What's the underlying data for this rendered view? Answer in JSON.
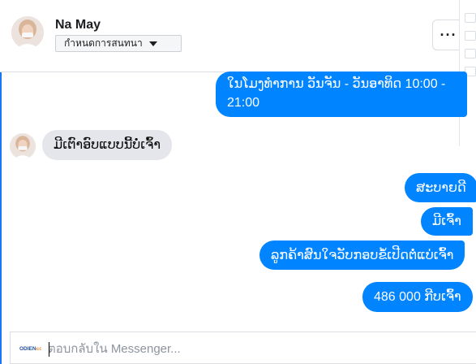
{
  "header": {
    "name": "Na May",
    "conversation_button_label": "กำหนดการสนทนา",
    "more_label": "···"
  },
  "messages": [
    {
      "direction": "outgoing",
      "text": "ໃນໂມງທຳການ ວັນຈັນ - ວັນອາທິດ  10:00 - 21:00"
    },
    {
      "direction": "incoming",
      "text": "ມີເຕົາອົບແບບນີ້ບໍ່ເຈົ້າ"
    },
    {
      "direction": "outgoing",
      "text": "ສະບາຍດີ"
    },
    {
      "direction": "outgoing",
      "text": "ມີເຈົ້າ"
    },
    {
      "direction": "outgoing",
      "text": "ລູກຄ້າສົນໃຈວັບກອບຂໍ້ເປີດຕໍ່ແບ່ເຈົ້າ"
    },
    {
      "direction": "outgoing",
      "text": "486 000 ກີບເຈົ້າ"
    }
  ],
  "composer": {
    "placeholder": "ตอบกลับใน Messenger...",
    "logo_text": "ODIENcom"
  },
  "colors": {
    "outgoing_bubble": "#0084ff",
    "incoming_bubble": "#e4e6eb",
    "accent": "#1877f2"
  }
}
